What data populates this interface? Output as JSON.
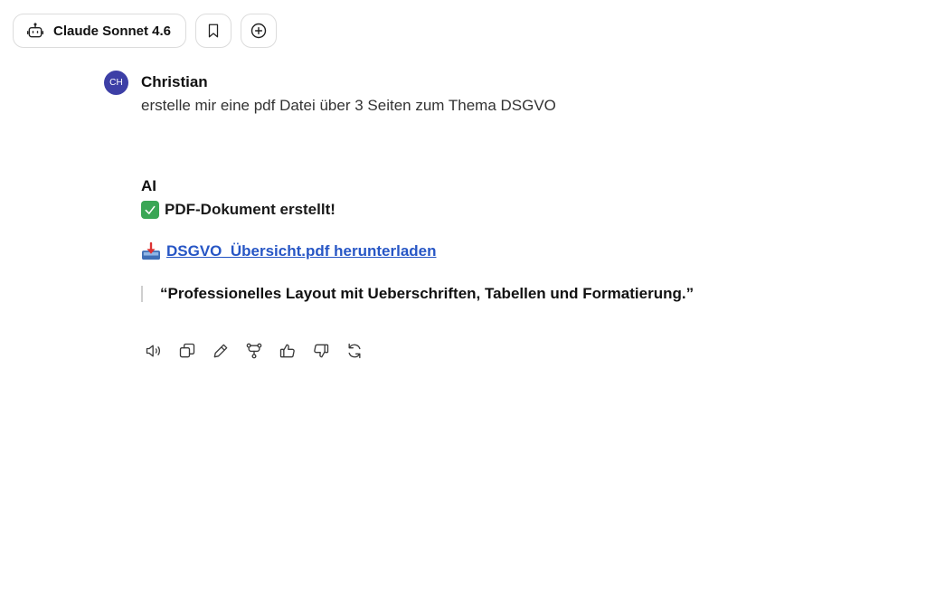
{
  "header": {
    "model_name": "Claude Sonnet 4.6",
    "icons": [
      "robot-icon",
      "bookmark-icon",
      "plus-circle-icon"
    ]
  },
  "user_message": {
    "avatar_initials": "CH",
    "avatar_color": "#3d3fa6",
    "name": "Christian",
    "text": "erstelle mir eine pdf Datei über 3 Seiten zum Thema DSGVO"
  },
  "ai_message": {
    "name": "AI",
    "status_text": "PDF-Dokument erstellt!",
    "status_icon": "check-mark-icon",
    "download_icon": "inbox-tray-icon",
    "download_link": "DSGVO_Übersicht.pdf herunterladen",
    "link_color": "#2756c5",
    "quote": "“Professionelles Layout mit Ueberschriften, Tabellen und Formatierung.”"
  },
  "actions": [
    "read-aloud-icon",
    "copy-icon",
    "edit-icon",
    "branch-icon",
    "thumbs-up-icon",
    "thumbs-down-icon",
    "regenerate-icon"
  ]
}
